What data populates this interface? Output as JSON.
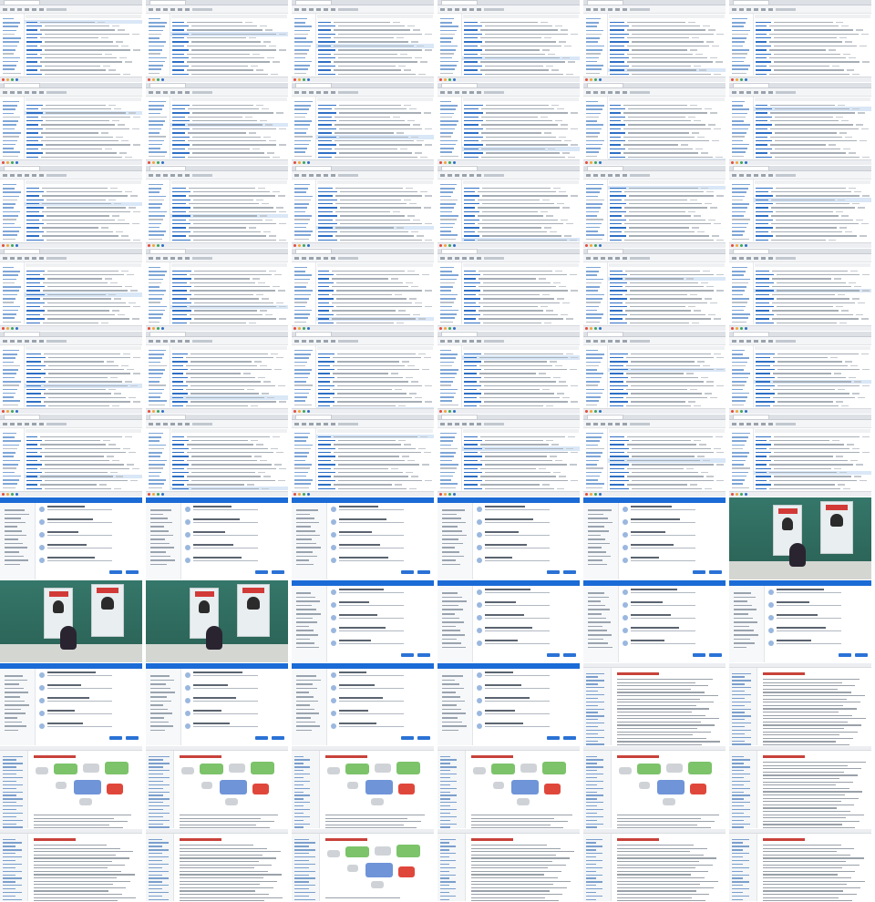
{
  "window": {
    "type": "contact-sheet"
  },
  "sheet": {
    "columns": 6,
    "frames": [
      {
        "id": "f01",
        "kind": "mail"
      },
      {
        "id": "f02",
        "kind": "mail"
      },
      {
        "id": "f03",
        "kind": "mail"
      },
      {
        "id": "f04",
        "kind": "mail"
      },
      {
        "id": "f05",
        "kind": "mail"
      },
      {
        "id": "f06",
        "kind": "mail"
      },
      {
        "id": "f07",
        "kind": "mail"
      },
      {
        "id": "f08",
        "kind": "mail"
      },
      {
        "id": "f09",
        "kind": "mail"
      },
      {
        "id": "f10",
        "kind": "mail"
      },
      {
        "id": "f11",
        "kind": "mail"
      },
      {
        "id": "f12",
        "kind": "mail"
      },
      {
        "id": "f13",
        "kind": "mail"
      },
      {
        "id": "f14",
        "kind": "mail"
      },
      {
        "id": "f15",
        "kind": "mail"
      },
      {
        "id": "f16",
        "kind": "mail"
      },
      {
        "id": "f17",
        "kind": "mail"
      },
      {
        "id": "f18",
        "kind": "mail"
      },
      {
        "id": "f19",
        "kind": "mail"
      },
      {
        "id": "f20",
        "kind": "mail"
      },
      {
        "id": "f21",
        "kind": "mail"
      },
      {
        "id": "f22",
        "kind": "mail"
      },
      {
        "id": "f23",
        "kind": "mail"
      },
      {
        "id": "f24",
        "kind": "mail"
      },
      {
        "id": "f25",
        "kind": "mail"
      },
      {
        "id": "f26",
        "kind": "mail"
      },
      {
        "id": "f27",
        "kind": "mail"
      },
      {
        "id": "f28",
        "kind": "mail"
      },
      {
        "id": "f29",
        "kind": "mail"
      },
      {
        "id": "f30",
        "kind": "mail"
      },
      {
        "id": "f31",
        "kind": "mail"
      },
      {
        "id": "f32",
        "kind": "mail"
      },
      {
        "id": "f33",
        "kind": "mail"
      },
      {
        "id": "f34",
        "kind": "mail"
      },
      {
        "id": "f35",
        "kind": "mail"
      },
      {
        "id": "f36",
        "kind": "mail"
      },
      {
        "id": "f37",
        "kind": "teams"
      },
      {
        "id": "f38",
        "kind": "teams"
      },
      {
        "id": "f39",
        "kind": "teams"
      },
      {
        "id": "f40",
        "kind": "teams"
      },
      {
        "id": "f41",
        "kind": "teams"
      },
      {
        "id": "f42",
        "kind": "camera"
      },
      {
        "id": "f43",
        "kind": "camera"
      },
      {
        "id": "f44",
        "kind": "camera"
      },
      {
        "id": "f45",
        "kind": "teams"
      },
      {
        "id": "f46",
        "kind": "teams"
      },
      {
        "id": "f47",
        "kind": "teams"
      },
      {
        "id": "f48",
        "kind": "teams"
      },
      {
        "id": "f49",
        "kind": "teams"
      },
      {
        "id": "f50",
        "kind": "teams"
      },
      {
        "id": "f51",
        "kind": "teams"
      },
      {
        "id": "f52",
        "kind": "teams"
      },
      {
        "id": "f53",
        "kind": "doc"
      },
      {
        "id": "f54",
        "kind": "doc"
      },
      {
        "id": "f55",
        "kind": "doc-diagram"
      },
      {
        "id": "f56",
        "kind": "doc-diagram"
      },
      {
        "id": "f57",
        "kind": "doc-diagram"
      },
      {
        "id": "f58",
        "kind": "doc-diagram"
      },
      {
        "id": "f59",
        "kind": "doc-diagram"
      },
      {
        "id": "f60",
        "kind": "doc"
      },
      {
        "id": "f61",
        "kind": "doc"
      },
      {
        "id": "f62",
        "kind": "doc"
      },
      {
        "id": "f63",
        "kind": "doc-diagram"
      },
      {
        "id": "f64",
        "kind": "doc"
      },
      {
        "id": "f65",
        "kind": "doc"
      },
      {
        "id": "f66",
        "kind": "doc"
      }
    ]
  },
  "colors": {
    "mail_link": "#2f6fc4",
    "teams_bar": "#1b6bd6",
    "camera_wall": "#2e6b5e",
    "doc_heading": "#c8423a",
    "diagram_green": "#7cc36a",
    "diagram_blue": "#6f94d8",
    "diagram_red": "#e0473b",
    "diagram_gray": "#cfd3d7"
  },
  "icons": {
    "status_dots": [
      "#e34b3c",
      "#f0a63a",
      "#3aa65b",
      "#2f6fc4"
    ]
  }
}
